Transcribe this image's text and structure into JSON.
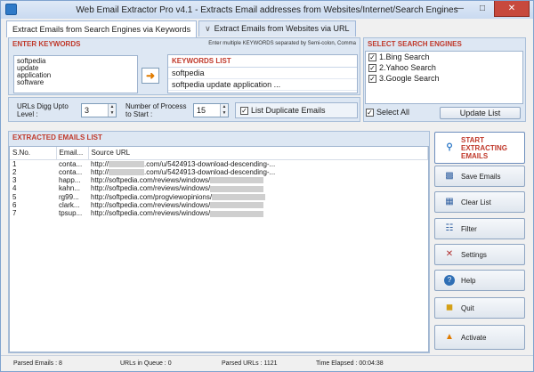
{
  "window": {
    "title": "Web Email Extractor Pro v4.1 - Extracts Email addresses from Websites/Internet/Search Engines"
  },
  "tabs": [
    {
      "label": "Extract Emails from Search Engines via Keywords"
    },
    {
      "label": "Extract Emails from Websites via URL"
    }
  ],
  "enter_keywords": {
    "header": "ENTER KEYWORDS",
    "note": "Enter multiple KEYWORDS separated by Semi-colon, Comma",
    "lines": [
      "softpedia",
      "update",
      "application",
      "software"
    ]
  },
  "keywords_list": {
    "header": "KEYWORDS LIST",
    "items": [
      "softpedia",
      "softpedia update application ..."
    ]
  },
  "options": {
    "urls_digg_label": "URLs Digg Upto Level :",
    "urls_digg_value": "3",
    "process_label": "Number of Process to Start :",
    "process_value": "15",
    "list_duplicate_label": "List Duplicate Emails",
    "list_duplicate_checked": true
  },
  "search_engines": {
    "header": "SELECT SEARCH ENGINES",
    "items": [
      {
        "label": "1.Bing Search",
        "checked": true
      },
      {
        "label": "2.Yahoo Search",
        "checked": true
      },
      {
        "label": "3.Google Search",
        "checked": true
      }
    ],
    "select_all_label": "Select All",
    "select_all_checked": true,
    "update_list_label": "Update List"
  },
  "extracted": {
    "header": "EXTRACTED EMAILS LIST",
    "columns": [
      "S.No.",
      "Email...",
      "Source URL"
    ],
    "rows": [
      {
        "sno": "1",
        "email": "conta...",
        "url_prefix": "http://",
        "url_suffix": ".com/u/5424913-download-descending-..."
      },
      {
        "sno": "2",
        "email": "conta...",
        "url_prefix": "http://",
        "url_suffix": ".com/u/5424913-download-descending-..."
      },
      {
        "sno": "3",
        "email": "happ...",
        "url_prefix": "http://softpedia.com/reviews/windows/",
        "url_suffix": ""
      },
      {
        "sno": "4",
        "email": "kahn...",
        "url_prefix": "http://softpedia.com/reviews/windows/",
        "url_suffix": ""
      },
      {
        "sno": "5",
        "email": "rg99...",
        "url_prefix": "http://softpedia.com/progviewopinions/",
        "url_suffix": ""
      },
      {
        "sno": "6",
        "email": "clark...",
        "url_prefix": "http://softpedia.com/reviews/windows/",
        "url_suffix": ""
      },
      {
        "sno": "7",
        "email": "tpsup...",
        "url_prefix": "http://softpedia.com/reviews/windows/",
        "url_suffix": ""
      }
    ]
  },
  "side_buttons": {
    "start": "START EXTRACTING EMAILS",
    "save": "Save Emails",
    "clear": "Clear List",
    "filter": "Filter",
    "settings": "Settings",
    "help": "Help",
    "quit": "Quit",
    "activate": "Activate"
  },
  "status": {
    "parsed_emails": "Parsed Emails :  8",
    "urls_in_queue": "URLs in Queue :  0",
    "parsed_urls": "Parsed URLs :  1121",
    "time_elapsed": "Time Elapsed :   00:04:38"
  },
  "colors": {
    "accent_red": "#c0392b",
    "panel_blue": "#dde7f3",
    "close_red": "#c7493d"
  }
}
